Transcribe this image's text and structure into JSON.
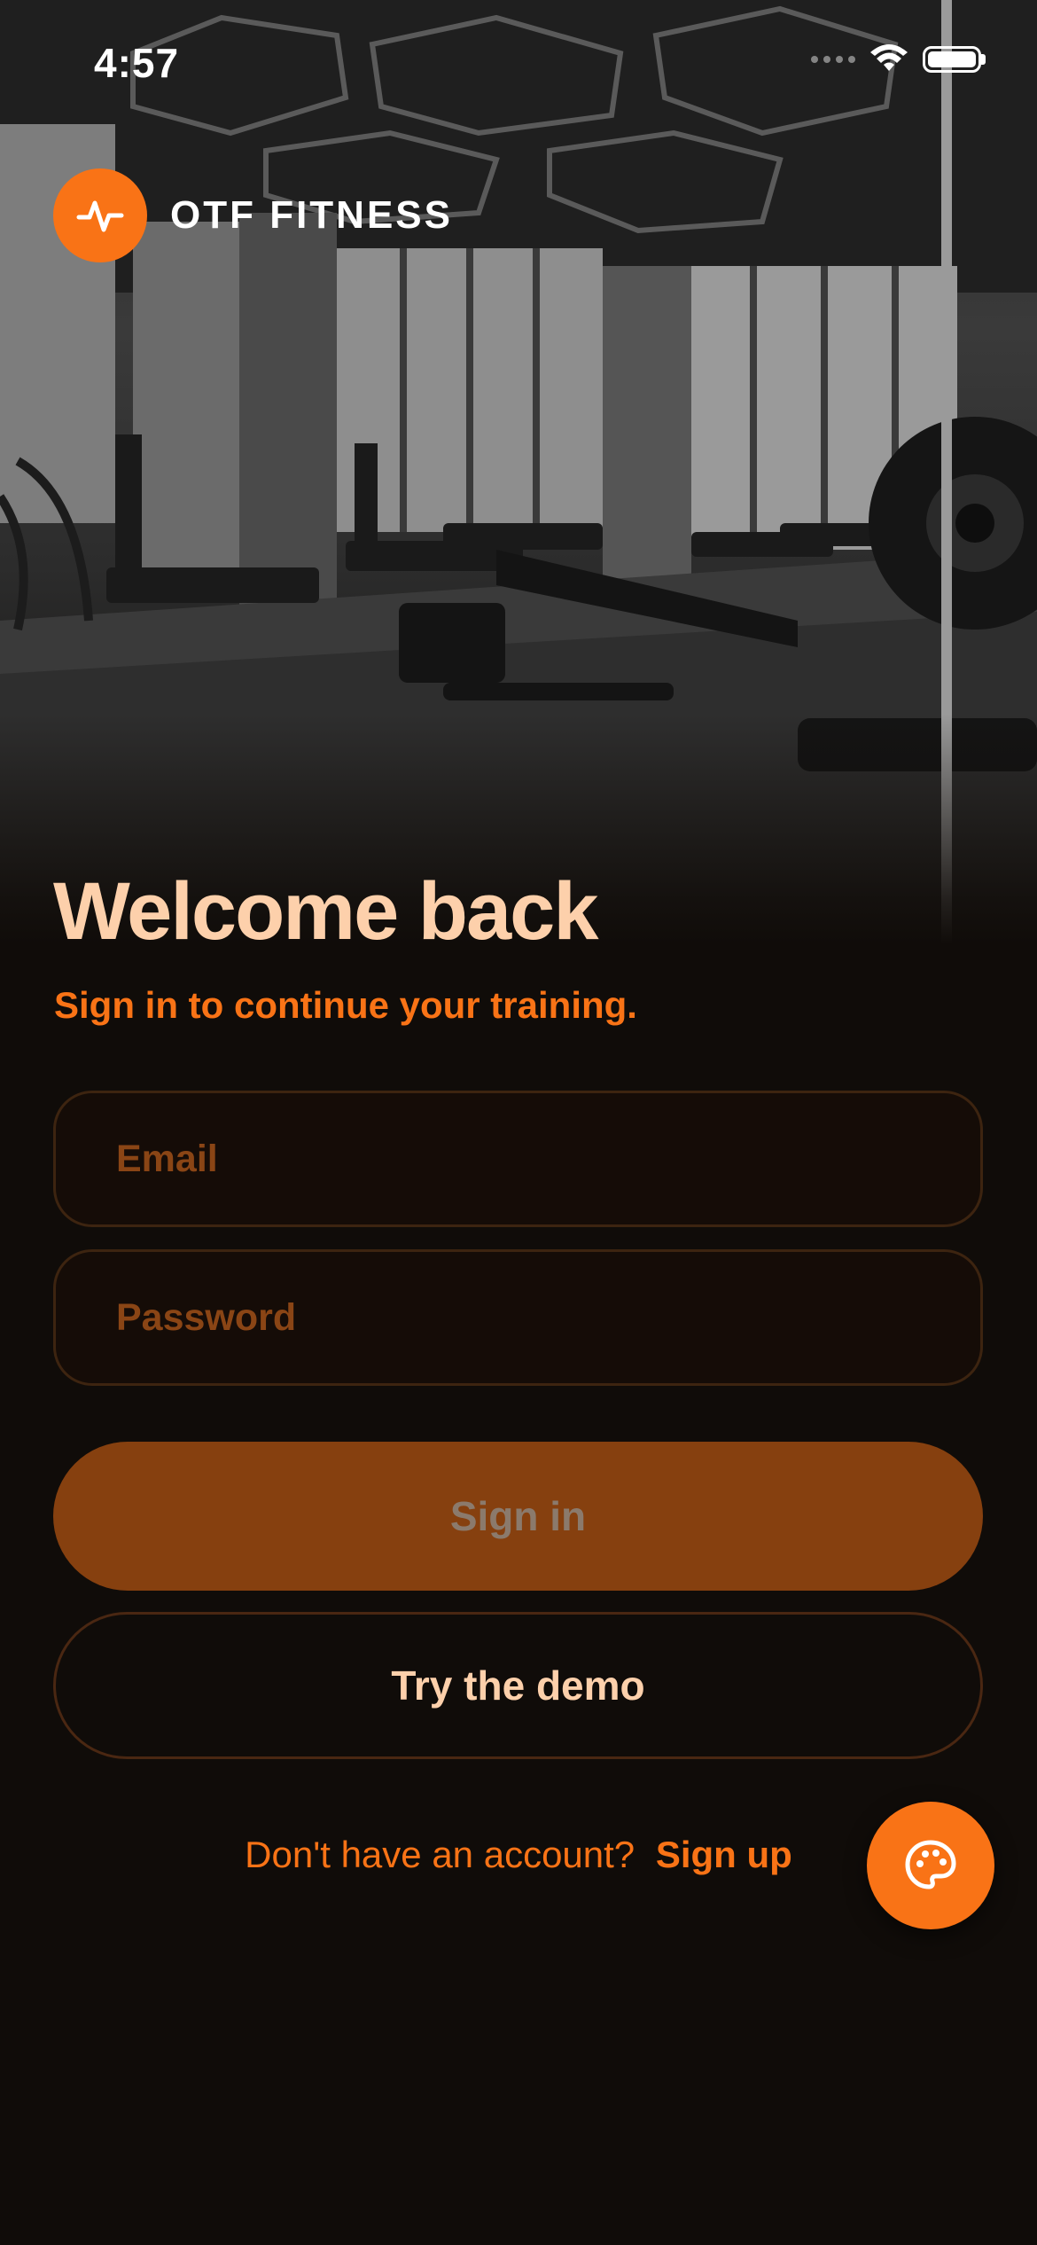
{
  "status_bar": {
    "time": "4:57"
  },
  "brand": {
    "name": "OTF FITNESS",
    "logo_icon": "pulse-icon"
  },
  "hero": {
    "title": "Welcome back",
    "subtitle": "Sign in to continue your training."
  },
  "form": {
    "email": {
      "placeholder": "Email",
      "value": ""
    },
    "password": {
      "placeholder": "Password",
      "value": ""
    }
  },
  "actions": {
    "sign_in_label": "Sign in",
    "demo_label": "Try the demo"
  },
  "signup": {
    "prompt": "Don't have an account?",
    "link": "Sign up"
  },
  "fab": {
    "icon": "palette-icon"
  },
  "colors": {
    "accent": "#f97316",
    "title": "#fdd0ab",
    "background": "#100c09",
    "button_disabled": "#86400f"
  }
}
